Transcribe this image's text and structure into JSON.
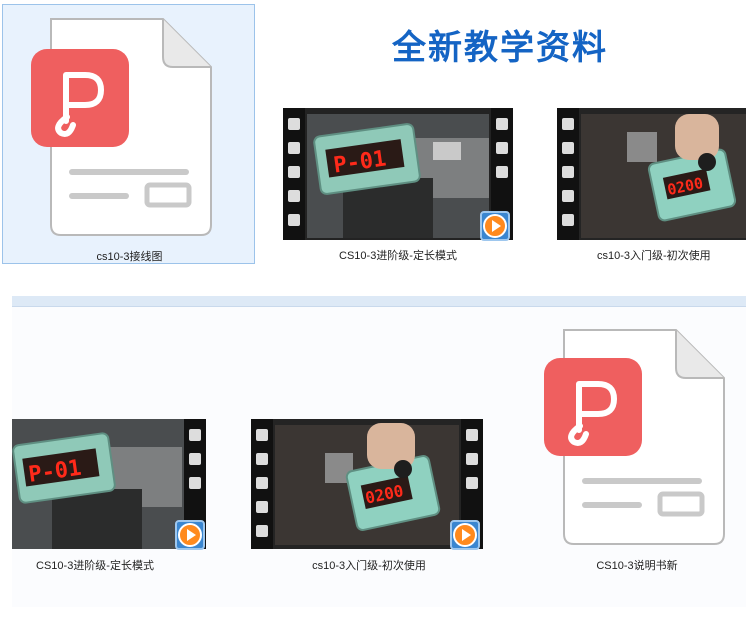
{
  "banner": {
    "title": "全新教学资料"
  },
  "top_row": [
    {
      "type": "pdf",
      "name": "cs10-3接线图",
      "selected": true
    },
    {
      "type": "video",
      "name": "CS10-3进阶级-定长模式",
      "display": "P-01"
    },
    {
      "type": "video",
      "name": "cs10-3入门级-初次使用",
      "display": "0200"
    }
  ],
  "bottom_row": [
    {
      "type": "video",
      "name": "CS10-3进阶级-定长模式",
      "display": "P-01"
    },
    {
      "type": "video",
      "name": "cs10-3入门级-初次使用",
      "display": "0200"
    },
    {
      "type": "pdf",
      "name": "CS10-3说明书新"
    }
  ],
  "icons": {
    "pdf": "pdf-file-icon",
    "video": "video-file-icon",
    "play": "play-badge-icon"
  },
  "colors": {
    "title": "#1464c4",
    "pdf_badge": "#ef5f5f",
    "selection_bg": "#e8f2fd",
    "selection_border": "#9cc3ea",
    "led": "#ff2a1a",
    "play_badge": "#ff8a1e"
  }
}
